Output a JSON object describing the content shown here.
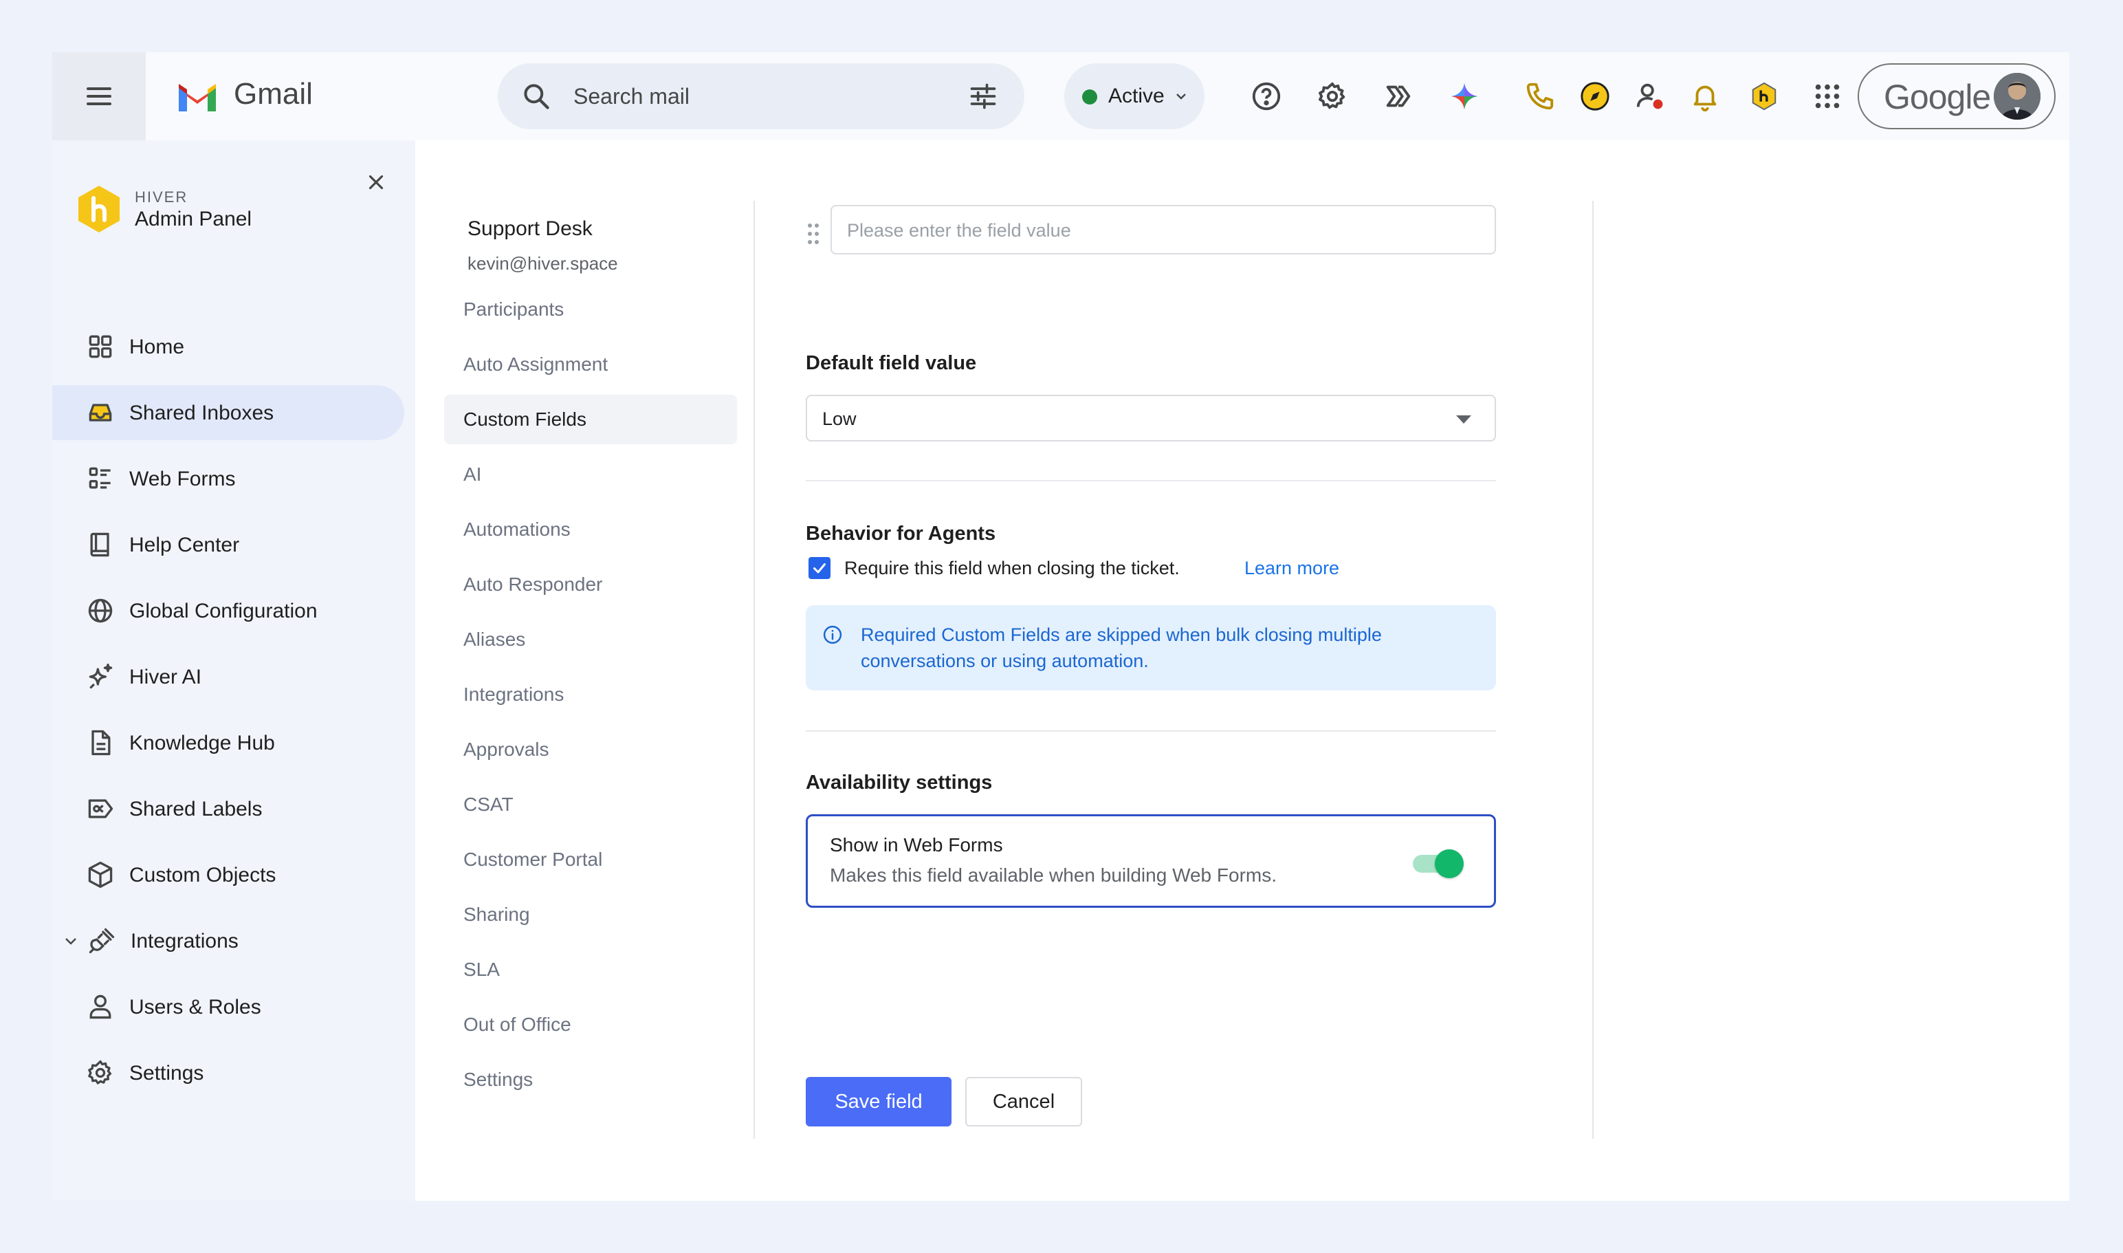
{
  "topbar": {
    "app_name": "Gmail",
    "search_placeholder": "Search mail",
    "status_label": "Active",
    "account_brand": "Google",
    "icons": [
      "menu-icon",
      "search-icon",
      "tune-icon",
      "help-icon",
      "settings-icon",
      "apps-script-icon",
      "gemini-icon",
      "phone-icon",
      "compass-icon",
      "user-alert-icon",
      "bell-icon",
      "hiver-icon",
      "apps-grid-icon"
    ]
  },
  "sidebar": {
    "brand_small": "HIVER",
    "brand_title": "Admin Panel",
    "items": [
      {
        "label": "Home",
        "icon": "grid-icon"
      },
      {
        "label": "Shared Inboxes",
        "icon": "inbox-icon",
        "active": true
      },
      {
        "label": "Web Forms",
        "icon": "form-icon"
      },
      {
        "label": "Help Center",
        "icon": "book-icon"
      },
      {
        "label": "Global Configuration",
        "icon": "globe-icon"
      },
      {
        "label": "Hiver AI",
        "icon": "sparkle-icon"
      },
      {
        "label": "Knowledge Hub",
        "icon": "document-icon"
      },
      {
        "label": "Shared Labels",
        "icon": "label-icon"
      },
      {
        "label": "Custom Objects",
        "icon": "cube-icon"
      },
      {
        "label": "Integrations",
        "icon": "plug-icon",
        "expandable": true
      },
      {
        "label": "Users & Roles",
        "icon": "user-icon"
      },
      {
        "label": "Settings",
        "icon": "gear-icon"
      }
    ]
  },
  "inbox": {
    "name": "Support Desk",
    "email": "kevin@hiver.space",
    "menu": [
      "Participants",
      "Auto Assignment",
      "Custom Fields",
      "AI",
      "Automations",
      "Auto Responder",
      "Aliases",
      "Integrations",
      "Approvals",
      "CSAT",
      "Customer Portal",
      "Sharing",
      "SLA",
      "Out of Office",
      "Settings"
    ],
    "active_menu": "Custom Fields"
  },
  "form": {
    "field_value_placeholder": "Please enter the field value",
    "default_value_label": "Default field value",
    "default_value": "Low",
    "behavior_heading": "Behavior for Agents",
    "require_label": "Require this field when closing the ticket.",
    "require_checked": true,
    "learn_more": "Learn more",
    "info_text": "Required Custom Fields are skipped when bulk closing multiple conversations or using automation.",
    "availability_heading": "Availability settings",
    "web_forms_title": "Show in Web Forms",
    "web_forms_desc": "Makes this field available when building Web Forms.",
    "web_forms_enabled": true,
    "save_label": "Save field",
    "cancel_label": "Cancel"
  },
  "colors": {
    "primary_button": "#4A6CF7",
    "toggle_on": "#12B76A",
    "link": "#1A73E8",
    "info_bg": "#E3F0FD",
    "active_nav_bg": "#E1E8F9",
    "hiver_yellow": "#F5C518"
  }
}
